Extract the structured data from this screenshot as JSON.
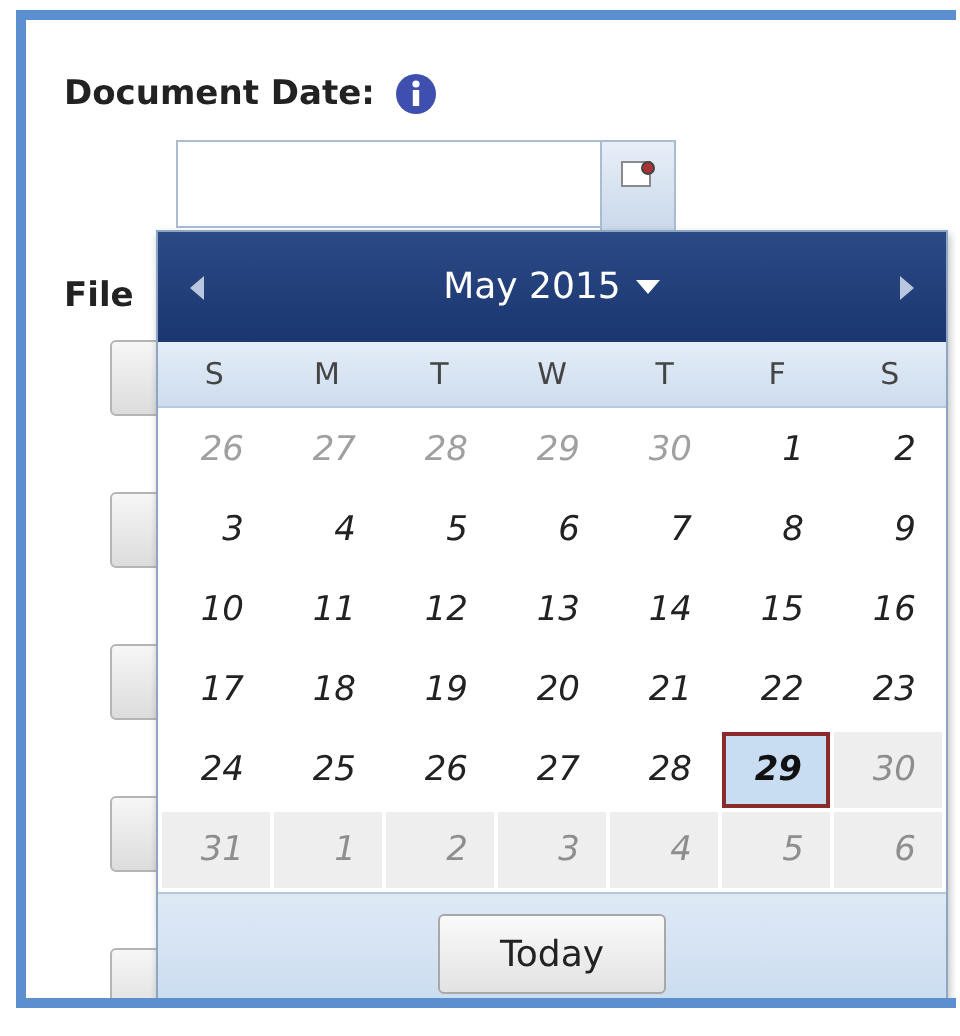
{
  "field": {
    "label": "Document Date:"
  },
  "hidden_label": "File",
  "calendar": {
    "month_title": "May 2015",
    "weekdays": [
      "S",
      "M",
      "T",
      "W",
      "T",
      "F",
      "S"
    ],
    "days": [
      {
        "label": "26",
        "other_month": true,
        "disabled": false,
        "selected": false
      },
      {
        "label": "27",
        "other_month": true,
        "disabled": false,
        "selected": false
      },
      {
        "label": "28",
        "other_month": true,
        "disabled": false,
        "selected": false
      },
      {
        "label": "29",
        "other_month": true,
        "disabled": false,
        "selected": false
      },
      {
        "label": "30",
        "other_month": true,
        "disabled": false,
        "selected": false
      },
      {
        "label": "1",
        "other_month": false,
        "disabled": false,
        "selected": false
      },
      {
        "label": "2",
        "other_month": false,
        "disabled": false,
        "selected": false
      },
      {
        "label": "3",
        "other_month": false,
        "disabled": false,
        "selected": false
      },
      {
        "label": "4",
        "other_month": false,
        "disabled": false,
        "selected": false
      },
      {
        "label": "5",
        "other_month": false,
        "disabled": false,
        "selected": false
      },
      {
        "label": "6",
        "other_month": false,
        "disabled": false,
        "selected": false
      },
      {
        "label": "7",
        "other_month": false,
        "disabled": false,
        "selected": false
      },
      {
        "label": "8",
        "other_month": false,
        "disabled": false,
        "selected": false
      },
      {
        "label": "9",
        "other_month": false,
        "disabled": false,
        "selected": false
      },
      {
        "label": "10",
        "other_month": false,
        "disabled": false,
        "selected": false
      },
      {
        "label": "11",
        "other_month": false,
        "disabled": false,
        "selected": false
      },
      {
        "label": "12",
        "other_month": false,
        "disabled": false,
        "selected": false
      },
      {
        "label": "13",
        "other_month": false,
        "disabled": false,
        "selected": false
      },
      {
        "label": "14",
        "other_month": false,
        "disabled": false,
        "selected": false
      },
      {
        "label": "15",
        "other_month": false,
        "disabled": false,
        "selected": false
      },
      {
        "label": "16",
        "other_month": false,
        "disabled": false,
        "selected": false
      },
      {
        "label": "17",
        "other_month": false,
        "disabled": false,
        "selected": false
      },
      {
        "label": "18",
        "other_month": false,
        "disabled": false,
        "selected": false
      },
      {
        "label": "19",
        "other_month": false,
        "disabled": false,
        "selected": false
      },
      {
        "label": "20",
        "other_month": false,
        "disabled": false,
        "selected": false
      },
      {
        "label": "21",
        "other_month": false,
        "disabled": false,
        "selected": false
      },
      {
        "label": "22",
        "other_month": false,
        "disabled": false,
        "selected": false
      },
      {
        "label": "23",
        "other_month": false,
        "disabled": false,
        "selected": false
      },
      {
        "label": "24",
        "other_month": false,
        "disabled": false,
        "selected": false
      },
      {
        "label": "25",
        "other_month": false,
        "disabled": false,
        "selected": false
      },
      {
        "label": "26",
        "other_month": false,
        "disabled": false,
        "selected": false
      },
      {
        "label": "27",
        "other_month": false,
        "disabled": false,
        "selected": false
      },
      {
        "label": "28",
        "other_month": false,
        "disabled": false,
        "selected": false
      },
      {
        "label": "29",
        "other_month": false,
        "disabled": false,
        "selected": true
      },
      {
        "label": "30",
        "other_month": false,
        "disabled": true,
        "selected": false
      },
      {
        "label": "31",
        "other_month": false,
        "disabled": true,
        "selected": false
      },
      {
        "label": "1",
        "other_month": true,
        "disabled": true,
        "selected": false
      },
      {
        "label": "2",
        "other_month": true,
        "disabled": true,
        "selected": false
      },
      {
        "label": "3",
        "other_month": true,
        "disabled": true,
        "selected": false
      },
      {
        "label": "4",
        "other_month": true,
        "disabled": true,
        "selected": false
      },
      {
        "label": "5",
        "other_month": true,
        "disabled": true,
        "selected": false
      },
      {
        "label": "6",
        "other_month": true,
        "disabled": true,
        "selected": false
      }
    ],
    "today_button": "Today"
  }
}
